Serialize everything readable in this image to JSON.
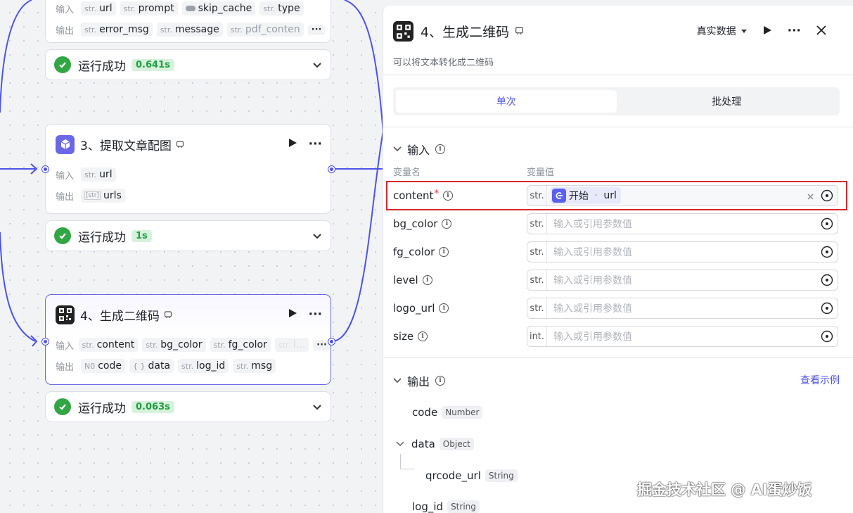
{
  "canvas": {
    "node2": {
      "input_label": "输入",
      "inputs": [
        {
          "type": "str.",
          "name": "url"
        },
        {
          "type": "str.",
          "name": "prompt"
        },
        {
          "type": "bool",
          "name": "skip_cache"
        },
        {
          "type": "str.",
          "name": "type"
        }
      ],
      "output_label": "输出",
      "outputs": [
        {
          "type": "str.",
          "name": "error_msg"
        },
        {
          "type": "str.",
          "name": "message"
        },
        {
          "type": "str.",
          "name": "pdf_conten"
        }
      ],
      "status": {
        "text": "运行成功",
        "time": "0.641s"
      }
    },
    "node3": {
      "title": "3、提取文章配图",
      "input_label": "输入",
      "inputs": [
        {
          "type": "str.",
          "name": "url"
        }
      ],
      "output_label": "输出",
      "outputs": [
        {
          "type": "[str]",
          "name": "urls"
        }
      ],
      "status": {
        "text": "运行成功",
        "time": "1s"
      }
    },
    "node4": {
      "title": "4、生成二维码",
      "input_label": "输入",
      "inputs": [
        {
          "type": "str.",
          "name": "content"
        },
        {
          "type": "str.",
          "name": "bg_color"
        },
        {
          "type": "str.",
          "name": "fg_color"
        },
        {
          "type": "str.",
          "name": "l..."
        }
      ],
      "output_label": "输出",
      "outputs": [
        {
          "type": "N0",
          "name": "code"
        },
        {
          "type": "{ }",
          "name": "data"
        },
        {
          "type": "str.",
          "name": "log_id"
        },
        {
          "type": "str.",
          "name": "msg"
        }
      ],
      "status": {
        "text": "运行成功",
        "time": "0.063s"
      }
    }
  },
  "panel": {
    "title": "4、生成二维码",
    "data_mode": "真实数据",
    "description": "可以将文本转化成二维码",
    "tabs": [
      {
        "label": "单次",
        "active": true
      },
      {
        "label": "批处理",
        "active": false
      }
    ],
    "input_section": "输入",
    "col_name": "变量名",
    "col_value": "变量值",
    "params": [
      {
        "name": "content",
        "required": "*",
        "type": "str.",
        "ref_node": "开始",
        "ref_sep": " · ",
        "ref_var": "url",
        "placeholder": ""
      },
      {
        "name": "bg_color",
        "type": "str.",
        "placeholder": "输入或引用参数值"
      },
      {
        "name": "fg_color",
        "type": "str.",
        "placeholder": "输入或引用参数值"
      },
      {
        "name": "level",
        "type": "str.",
        "placeholder": "输入或引用参数值"
      },
      {
        "name": "logo_url",
        "type": "str.",
        "placeholder": "输入或引用参数值"
      },
      {
        "name": "size",
        "type": "int.",
        "placeholder": "输入或引用参数值"
      }
    ],
    "output_section": "输出",
    "view_example": "查看示例",
    "outputs": [
      {
        "name": "code",
        "type": "Number"
      },
      {
        "name": "data",
        "type": "Object"
      },
      {
        "name": "qrcode_url",
        "type": "String"
      },
      {
        "name": "log_id",
        "type": "String"
      }
    ]
  },
  "watermark": "掘金技术社区 @ AI蛋炒饭",
  "colors": {
    "accent": "#4d53e8",
    "success": "#32a645",
    "highlight": "#d9272e"
  }
}
